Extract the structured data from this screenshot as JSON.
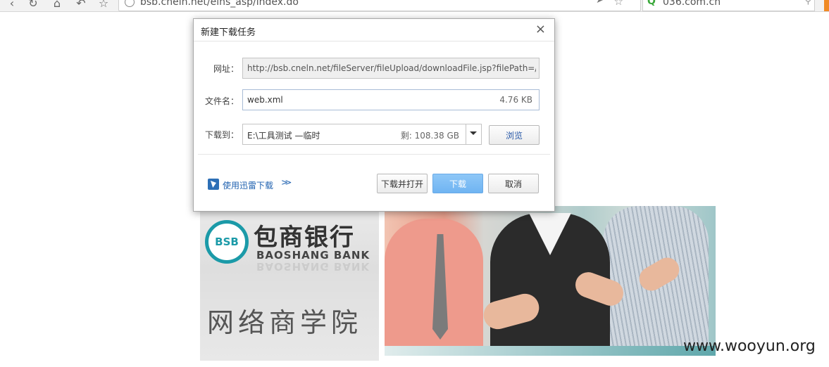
{
  "browser": {
    "address_url": "bsb.cneln.net/elns_asp/index.do",
    "search_text": "036.com.cn",
    "icons": [
      "back-icon",
      "refresh-icon",
      "home-icon",
      "undo-icon",
      "star-icon",
      "info-icon",
      "search-engine-icon"
    ]
  },
  "dialog": {
    "title": "新建下载任务",
    "close_symbol": "×",
    "url_label": "网址：",
    "url_value": "http://bsb.cneln.net/fileServer/fileUpload/downloadFile.jsp?filePath=/W",
    "filename_label": "文件名：",
    "filename_value": "web.xml",
    "file_size": "4.76 KB",
    "saveto_label": "下载到：",
    "saveto_value": "E:\\工具测试 —临时",
    "remaining_space": "剩: 108.38 GB",
    "browse_label": "浏览",
    "thunder_link": "使用迅雷下载",
    "thunder_chevron": "≫",
    "download_open_label": "下载并打开",
    "download_label": "下载",
    "cancel_label": "取消",
    "accent_color": "#6fb4f2"
  },
  "page": {
    "logo_text": "BSB",
    "bank_name_cn": "包商银行",
    "bank_name_en": "BAOSHANG BANK",
    "school_title": "网络商学院",
    "brand_color": "#1b9aa8"
  },
  "watermark": "www.wooyun.org"
}
